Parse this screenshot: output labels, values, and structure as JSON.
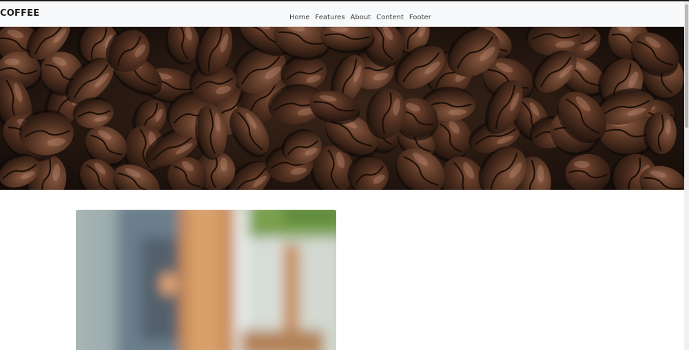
{
  "navbar": {
    "brand": "COFFEE",
    "links": [
      "Home",
      "Features",
      "About",
      "Content",
      "Footer"
    ]
  },
  "images": {
    "hero": "coffee-beans-photo",
    "card": "blurred-cafe-photo"
  },
  "colors": {
    "navbar_bg": "#f8f9fa",
    "brand_text": "#1a1a1a",
    "link_text": "#3a3a3a",
    "bean_brown": "#4a2c1e"
  }
}
